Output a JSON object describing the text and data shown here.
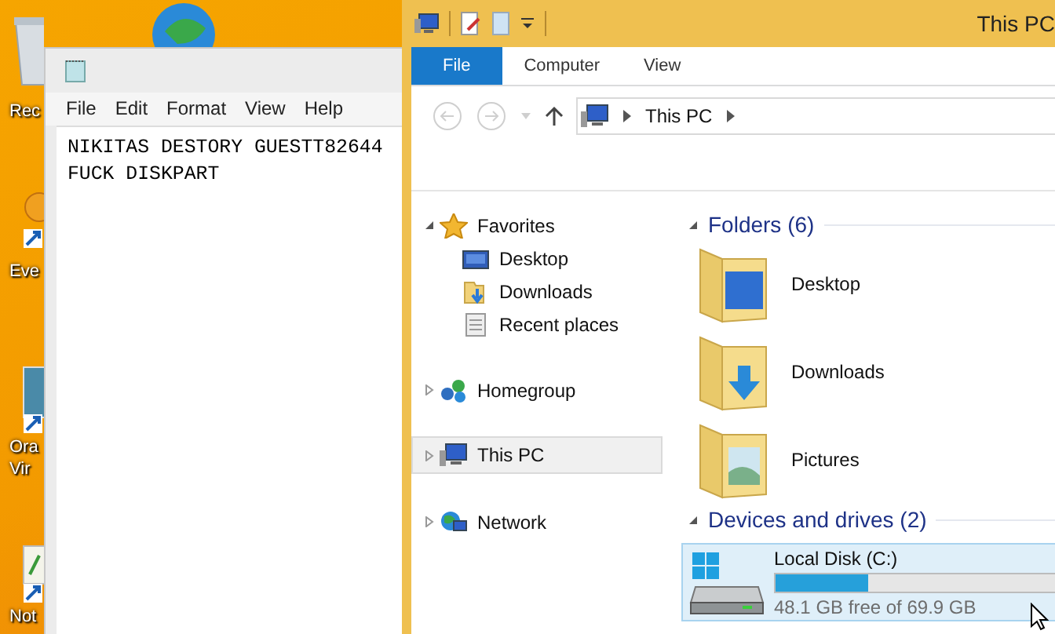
{
  "desktop": {
    "icons": [
      {
        "kind": "recycle",
        "lines": [
          "Rec"
        ]
      },
      {
        "kind": "globe"
      },
      {
        "kind": "event",
        "lines": [
          "Eve"
        ]
      },
      {
        "kind": "vbox",
        "lines": [
          "Ora",
          "Vir"
        ]
      },
      {
        "kind": "note",
        "lines": [
          "Not"
        ]
      }
    ]
  },
  "notepad": {
    "menu": [
      "File",
      "Edit",
      "Format",
      "View",
      "Help"
    ],
    "lines": [
      "NIKITAS DESTORY GUESTT82644",
      "FUCK DISKPART"
    ]
  },
  "explorer": {
    "title": "This PC",
    "ribbon_tabs": [
      {
        "label": "File",
        "selected": true
      },
      {
        "label": "Computer",
        "selected": false
      },
      {
        "label": "View",
        "selected": false
      }
    ],
    "address": {
      "path": [
        "This PC"
      ]
    },
    "nav": [
      {
        "label": "Favorites",
        "kind": "star",
        "expanded": true,
        "selected": false,
        "children": [
          {
            "label": "Desktop",
            "kind": "desktop"
          },
          {
            "label": "Downloads",
            "kind": "downloads"
          },
          {
            "label": "Recent places",
            "kind": "recent"
          }
        ]
      },
      {
        "label": "Homegroup",
        "kind": "homegroup",
        "expanded": false,
        "selected": false
      },
      {
        "label": "This PC",
        "kind": "pc",
        "expanded": false,
        "selected": true
      },
      {
        "label": "Network",
        "kind": "network",
        "expanded": false,
        "selected": false
      }
    ],
    "folders": {
      "title": "Folders (6)",
      "expanded": true,
      "items": [
        {
          "label": "Desktop",
          "kind": "desktop"
        },
        {
          "label": "Downloads",
          "kind": "downloads"
        },
        {
          "label": "Pictures",
          "kind": "pictures"
        }
      ]
    },
    "drives": {
      "title": "Devices and drives (2)",
      "expanded": true,
      "items": [
        {
          "label": "Local Disk (C:)",
          "level": 0.31,
          "free": "48.1 GB free of 69.9 GB",
          "selected": true
        }
      ]
    }
  }
}
